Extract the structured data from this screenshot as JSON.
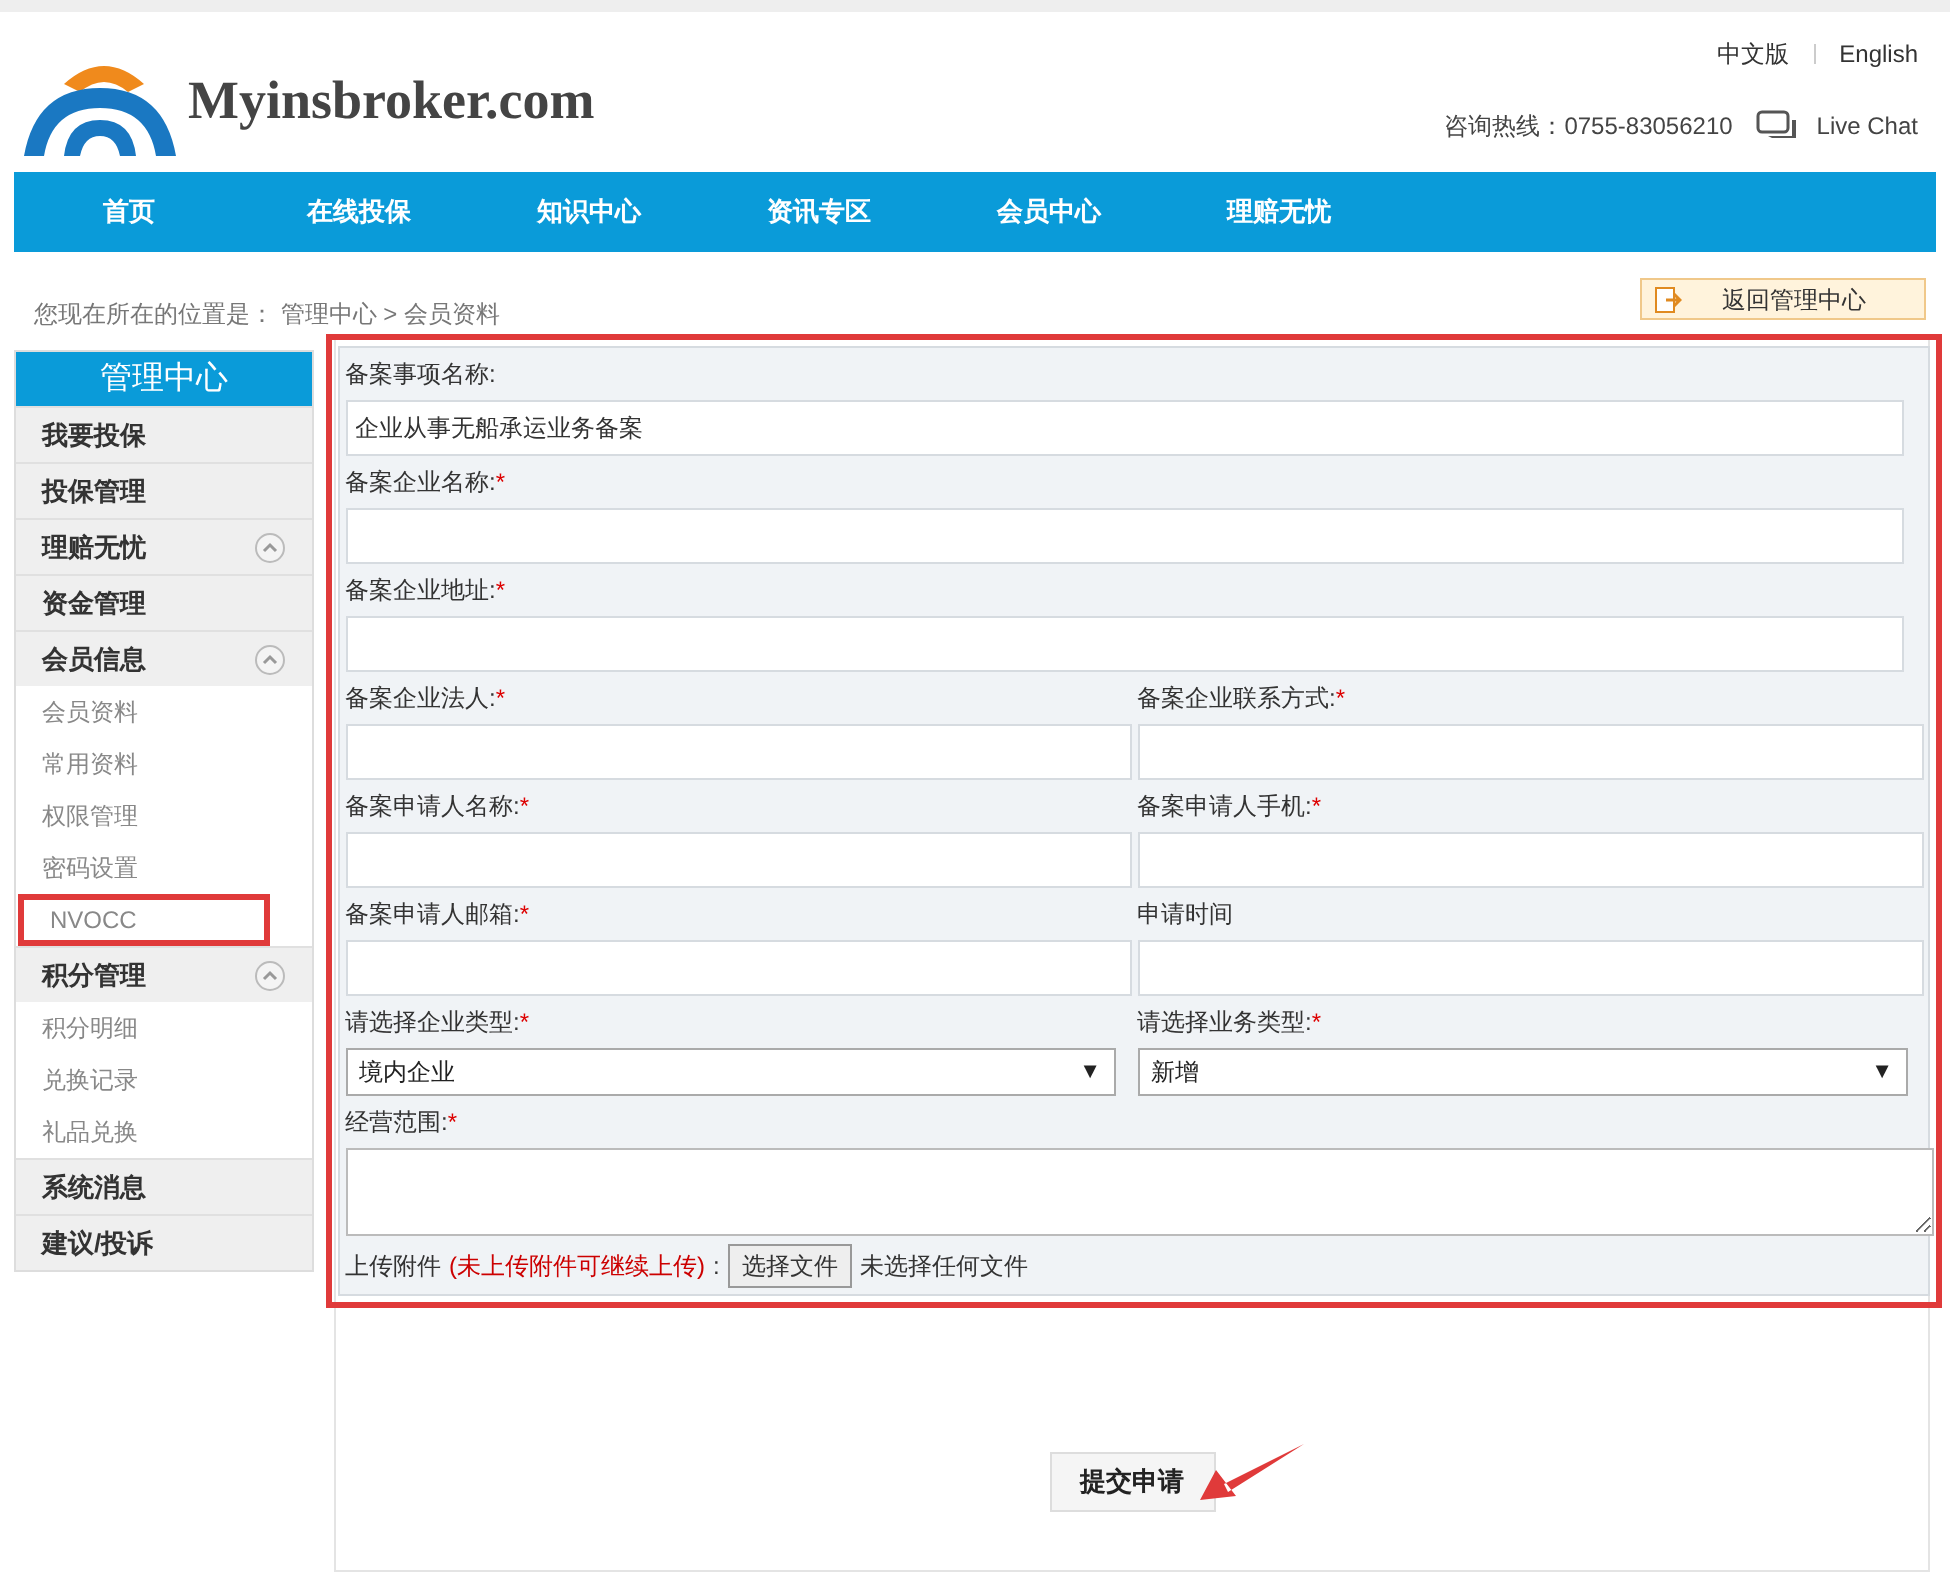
{
  "header": {
    "logo_text": "Myinsbroker.com",
    "languages": [
      "中文版",
      "English"
    ],
    "hotline": "咨询热线：0755-83056210",
    "chat": "Live Chat"
  },
  "nav": [
    "首页",
    "在线投保",
    "知识中心",
    "资讯专区",
    "会员中心",
    "理赔无忧"
  ],
  "breadcrumb": "您现在所在的位置是： 管理中心 > 会员资料",
  "back_button": "返回管理中心",
  "sidebar": {
    "title": "管理中心",
    "items": [
      {
        "label": "我要投保",
        "collapsible": false
      },
      {
        "label": "投保管理",
        "collapsible": false
      },
      {
        "label": "理赔无忧",
        "collapsible": true
      },
      {
        "label": "资金管理",
        "collapsible": false
      },
      {
        "label": "会员信息",
        "collapsible": true,
        "children": [
          {
            "label": "会员资料",
            "highlighted": false
          },
          {
            "label": "常用资料",
            "highlighted": false
          },
          {
            "label": "权限管理",
            "highlighted": false
          },
          {
            "label": "密码设置",
            "highlighted": false
          },
          {
            "label": "NVOCC",
            "highlighted": true
          }
        ]
      },
      {
        "label": "积分管理",
        "collapsible": true,
        "children": [
          {
            "label": "积分明细",
            "highlighted": false
          },
          {
            "label": "兑换记录",
            "highlighted": false
          },
          {
            "label": "礼品兑换",
            "highlighted": false
          }
        ]
      },
      {
        "label": "系统消息",
        "collapsible": false
      },
      {
        "label": "建议/投诉",
        "collapsible": false
      }
    ]
  },
  "form": {
    "highlighted": true,
    "rows": [
      [
        {
          "kind": "text",
          "label": "备案事项名称:",
          "value": "企业从事无船承运业务备案"
        }
      ],
      [
        {
          "kind": "text",
          "label": "备案企业名称:",
          "required_mark": "*"
        }
      ],
      [
        {
          "kind": "text",
          "label": "备案企业地址:",
          "required_mark": "*"
        }
      ],
      [
        {
          "kind": "text",
          "label": "备案企业法人:",
          "required_mark": "*"
        },
        {
          "kind": "text",
          "label": "备案企业联系方式:",
          "required_mark": "*"
        }
      ],
      [
        {
          "kind": "text",
          "label": "备案申请人名称:",
          "required_mark": "*"
        },
        {
          "kind": "text",
          "label": "备案申请人手机:",
          "required_mark": "*"
        }
      ],
      [
        {
          "kind": "text",
          "label": "备案申请人邮箱:",
          "required_mark": "*"
        },
        {
          "kind": "text",
          "label": "申请时间"
        }
      ],
      [
        {
          "kind": "select",
          "label": "请选择企业类型:",
          "required_mark": "*",
          "value": "境内企业",
          "arrow": "▼"
        },
        {
          "kind": "select",
          "label": "请选择业务类型:",
          "required_mark": "*",
          "value": "新增",
          "arrow": "▼"
        }
      ],
      [
        {
          "kind": "textarea",
          "label": "经营范围:",
          "required_mark": "*"
        }
      ]
    ],
    "upload": {
      "label": "上传附件",
      "note": "(未上传附件可继续上传)",
      "colon": ":",
      "button": "选择文件",
      "status": "未选择任何文件"
    }
  },
  "submit": "提交申请"
}
